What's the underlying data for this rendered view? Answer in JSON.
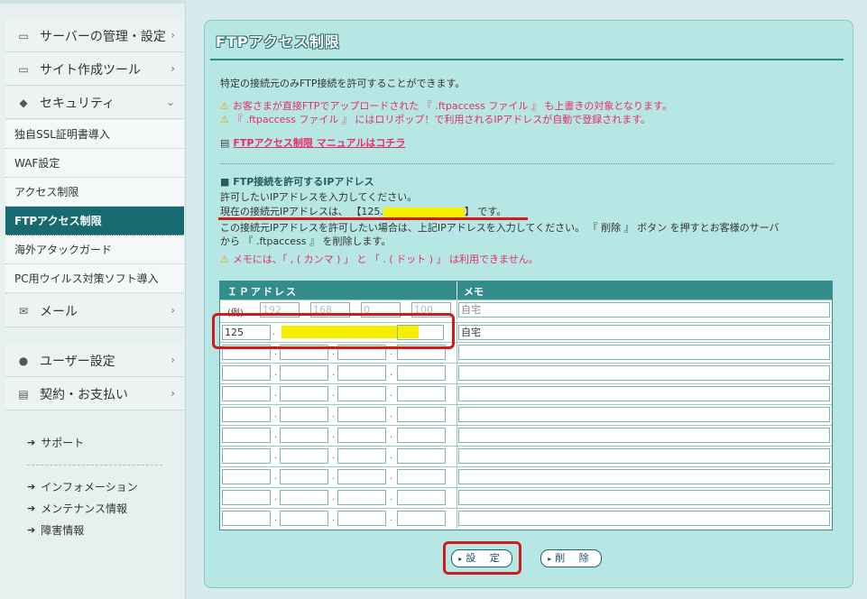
{
  "sidebar": {
    "main_items": [
      {
        "label": "サーバーの管理・設定",
        "icon": "server-icon"
      },
      {
        "label": "サイト作成ツール",
        "icon": "monitor-icon"
      },
      {
        "label": "セキュリティ",
        "icon": "shield-icon"
      },
      {
        "label": "メール",
        "icon": "mail-icon"
      },
      {
        "label": "ユーザー設定",
        "icon": "user-icon"
      },
      {
        "label": "契約・お支払い",
        "icon": "card-icon"
      }
    ],
    "security_sub": [
      {
        "label": "独自SSL証明書導入"
      },
      {
        "label": "WAF設定"
      },
      {
        "label": "アクセス制限"
      },
      {
        "label": "FTPアクセス制限",
        "active": true
      },
      {
        "label": "海外アタックガード"
      },
      {
        "label": "PC用ウイルス対策ソフト導入"
      }
    ],
    "links": [
      "サポート",
      "インフォメーション",
      "メンテナンス情報",
      "障害情報"
    ]
  },
  "panel": {
    "title": "FTPアクセス制限",
    "intro": "特定の接続元のみFTP接続を許可することができます。",
    "warning1": "お客さまが直接FTPでアップロードされた 『 .ftpaccess ファイル 』 も上書きの対象となります。",
    "warning2": "『 .ftpaccess ファイル 』 にはロリポップ！で利用されるIPアドレスが自動で登録されます。",
    "manual_link": "FTPアクセス制限 マニュアルはコチラ",
    "section_title": "■ FTP接続を許可するIPアドレス",
    "instruction": "許可したいIPアドレスを入力してください。",
    "current_ip_prefix": "現在の接続元IPアドレスは、 【125.",
    "current_ip_suffix": "】 です。",
    "desc_line1": "この接続元IPアドレスを許可したい場合は、上記IPアドレスを入力してください。 『 削除 』 ボタン を押すとお客様のサーバ",
    "desc_line2": "から 『 .ftpaccess 』 を削除します。",
    "memo_warning": "メモには、「 , ( カンマ ) 」 と 「 . ( ドット ) 」 は利用できません。"
  },
  "table": {
    "header_ip": "ＩＰアドレス",
    "header_memo": "メモ",
    "example_label": "(例)",
    "example_ip": [
      "192",
      "168",
      "0",
      "100"
    ],
    "example_memo": "自宅",
    "row1_ip_first": "125",
    "row1_memo": "自宅",
    "empty_rows": 9
  },
  "buttons": {
    "set_label": "設 定",
    "delete_label": "削 除"
  },
  "colors": {
    "accent": "#338e8b",
    "active_nav": "#176a70",
    "warning_text": "#e62d6b",
    "highlight_red": "#d11a1a",
    "mask_yellow": "#f7ef00"
  }
}
